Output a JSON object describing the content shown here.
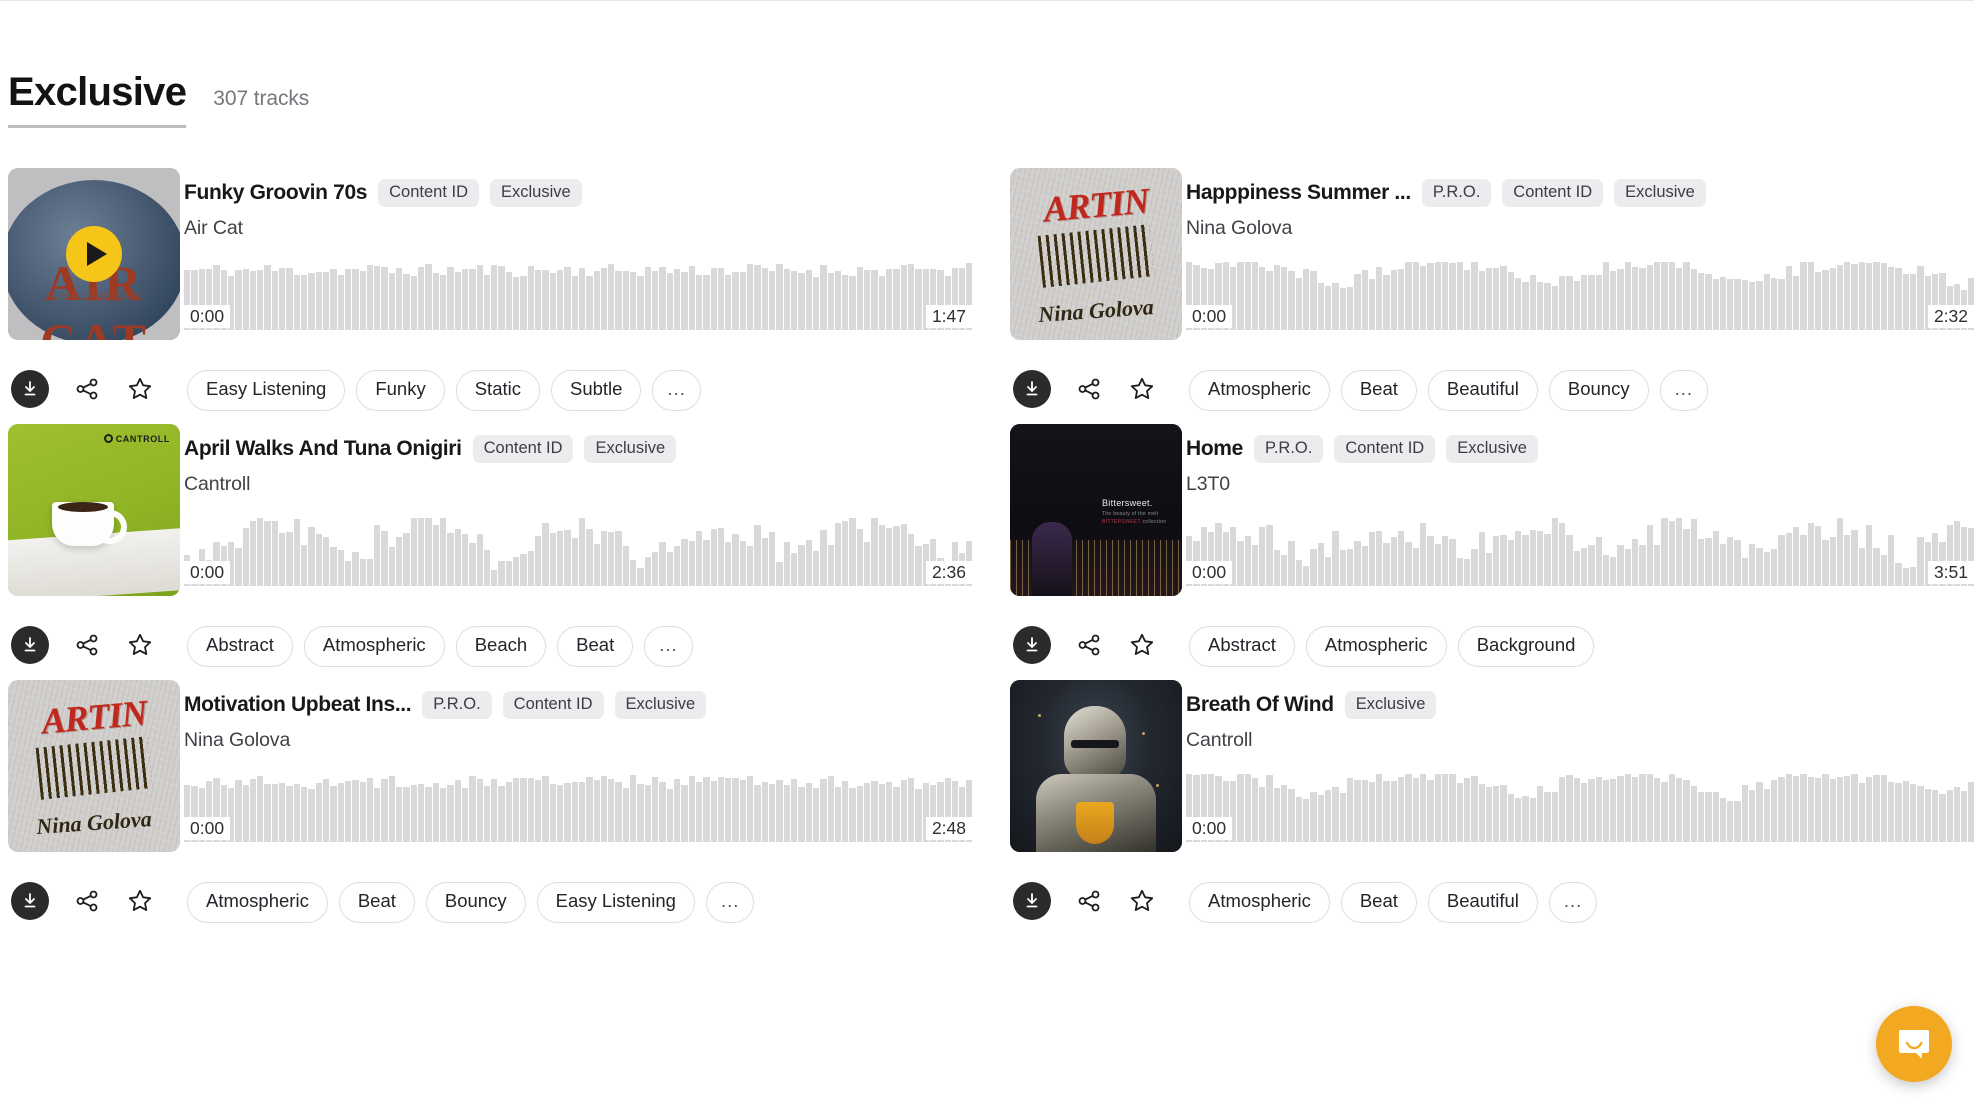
{
  "header": {
    "title": "Exclusive",
    "count": "307 tracks"
  },
  "icons": {
    "play": "play-icon",
    "download": "download-icon",
    "share": "share-icon",
    "favorite": "star-icon",
    "chat": "chat-bubble-icon"
  },
  "tracks": [
    {
      "title": "Funky Groovin 70s",
      "artist": "Air Cat",
      "badges": [
        "Content ID",
        "Exclusive"
      ],
      "time_start": "0:00",
      "time_end": "1:47",
      "tags": [
        "Easy Listening",
        "Funky",
        "Static",
        "Subtle",
        "..."
      ],
      "art": "air-cat-cover",
      "playing": true
    },
    {
      "title": "Happpiness Summer ...",
      "artist": "Nina Golova",
      "badges": [
        "P.R.O.",
        "Content ID",
        "Exclusive"
      ],
      "time_start": "0:00",
      "time_end": "2:32",
      "tags": [
        "Atmospheric",
        "Beat",
        "Beautiful",
        "Bouncy",
        "..."
      ],
      "art": "nina-golova-cover",
      "playing": false
    },
    {
      "title": "April Walks And Tuna Onigiri",
      "artist": "Cantroll",
      "badges": [
        "Content ID",
        "Exclusive"
      ],
      "time_start": "0:00",
      "time_end": "2:36",
      "tags": [
        "Abstract",
        "Atmospheric",
        "Beach",
        "Beat",
        "..."
      ],
      "art": "cantroll-cup-cover",
      "playing": false
    },
    {
      "title": "Home",
      "artist": "L3T0",
      "badges": [
        "P.R.O.",
        "Content ID",
        "Exclusive"
      ],
      "time_start": "0:00",
      "time_end": "3:51",
      "tags": [
        "Abstract",
        "Atmospheric",
        "Background"
      ],
      "art": "night-city-cover",
      "playing": false
    },
    {
      "title": "Motivation Upbeat Ins...",
      "artist": "Nina Golova",
      "badges": [
        "P.R.O.",
        "Content ID",
        "Exclusive"
      ],
      "time_start": "0:00",
      "time_end": "2:48",
      "tags": [
        "Atmospheric",
        "Beat",
        "Bouncy",
        "Easy Listening",
        "..."
      ],
      "art": "nina-golova-cover",
      "playing": false
    },
    {
      "title": "Breath Of Wind",
      "artist": "Cantroll",
      "badges": [
        "Exclusive"
      ],
      "time_start": "0:00",
      "time_end": "",
      "tags": [
        "Atmospheric",
        "Beat",
        "Beautiful",
        "..."
      ],
      "art": "knight-cover",
      "playing": false
    }
  ],
  "colors": {
    "accent_play": "#f5c518",
    "chat": "#f2a820",
    "badge_bg": "#ececee",
    "wave": "#d9d9dc"
  }
}
